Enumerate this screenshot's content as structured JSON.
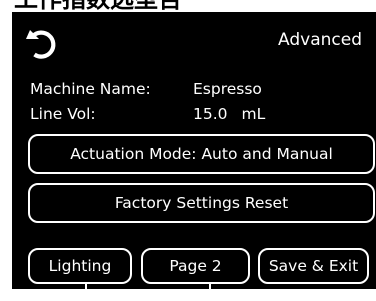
{
  "top_title": "工作指数选型告",
  "header": {
    "back_icon": "rotate-back-icon",
    "advanced_label": "Advanced"
  },
  "info": {
    "machine_name_label": "Machine Name:",
    "machine_name_value": "Espresso",
    "line_vol_label": "Line Vol:",
    "line_vol_value": "15.0",
    "line_vol_unit": "mL"
  },
  "buttons": {
    "actuation_mode_label": "Actuation Mode: Auto and Manual",
    "factory_reset_label": "Factory Settings Reset",
    "lighting_label": "Lighting",
    "page_label": "Page 2",
    "save_exit_label": "Save & Exit"
  },
  "colors": {
    "screen_background": "#000000",
    "foreground": "#ffffff"
  }
}
